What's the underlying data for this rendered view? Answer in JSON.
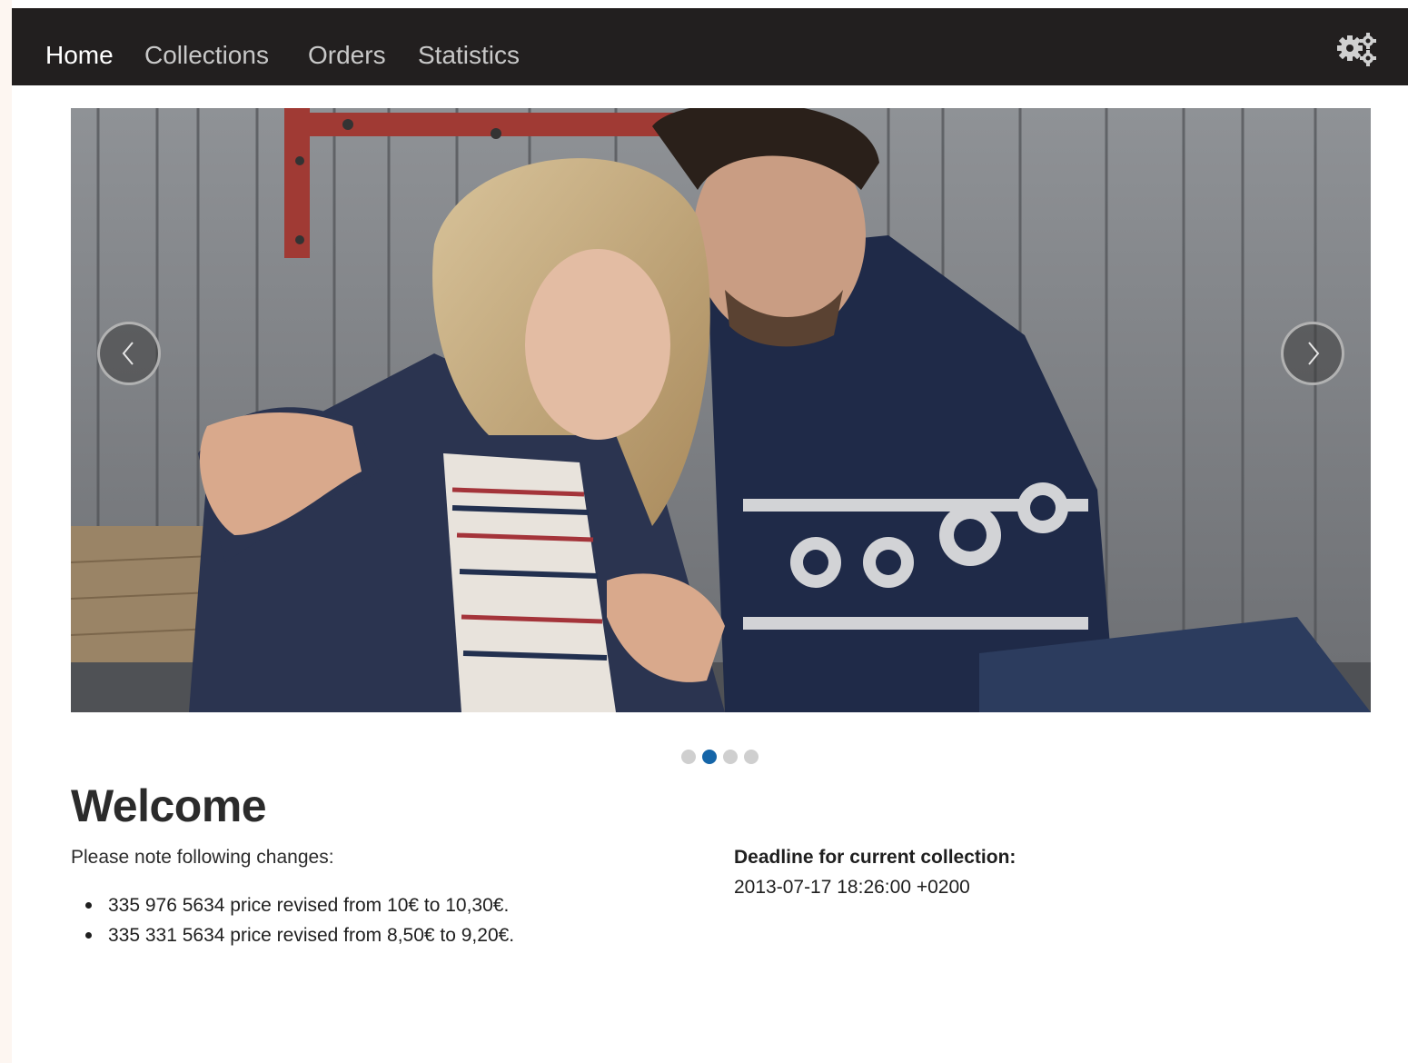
{
  "nav": {
    "items": [
      {
        "label": "Home",
        "active": true
      },
      {
        "label": "Collections",
        "active": false
      },
      {
        "label": "Orders",
        "active": false
      },
      {
        "label": "Statistics",
        "active": false
      }
    ],
    "settings_icon": "gears-icon"
  },
  "carousel": {
    "prev_icon": "chevron-left-icon",
    "next_icon": "chevron-right-icon",
    "slide_count": 4,
    "active_slide": 2
  },
  "content": {
    "heading": "Welcome",
    "intro": "Please note following changes:",
    "changes": [
      "335 976 5634 price revised from 10€ to 10,30€.",
      "335 331 5634 price revised from 8,50€ to 9,20€."
    ],
    "deadline_label": "Deadline for current collection:",
    "deadline_value": "2013-07-17 18:26:00 +0200"
  },
  "colors": {
    "navbar": "#221f1f",
    "nav_active": "#ffffff",
    "nav_inactive": "#c8c8c8",
    "dot_active": "#1565a8",
    "dot_inactive": "#cfcfcf"
  }
}
